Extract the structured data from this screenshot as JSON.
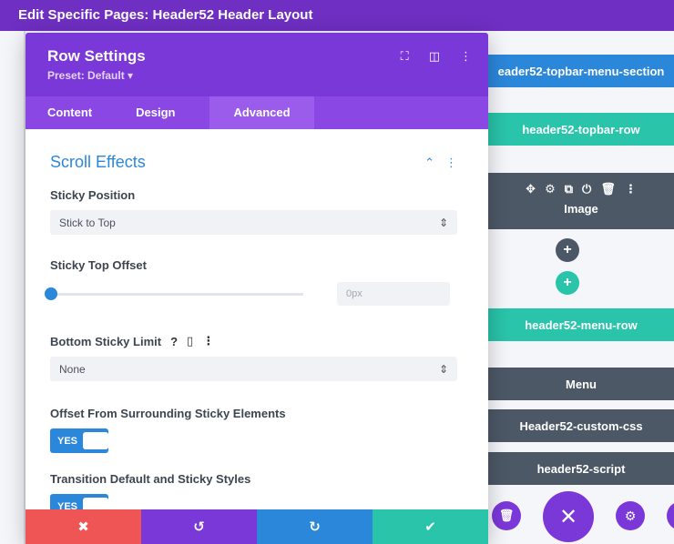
{
  "title_bar": {
    "text": "Edit Specific Pages: Header52 Header Layout"
  },
  "modal": {
    "title": "Row Settings",
    "preset": "Preset: Default ▾",
    "tabs": [
      {
        "label": "Content"
      },
      {
        "label": "Design"
      },
      {
        "label": "Advanced"
      }
    ],
    "section": {
      "title": "Scroll Effects"
    },
    "fields": {
      "sticky_position": {
        "label": "Sticky Position",
        "value": "Stick to Top"
      },
      "sticky_top_offset": {
        "label": "Sticky Top Offset",
        "value": "0px",
        "slider_fraction": 0.0
      },
      "bottom_sticky_limit": {
        "label": "Bottom Sticky Limit",
        "value": "None"
      },
      "offset_surrounding": {
        "label": "Offset From Surrounding Sticky Elements",
        "toggle": "YES"
      },
      "transition_default": {
        "label": "Transition Default and Sticky Styles",
        "toggle": "YES"
      }
    },
    "footer": {
      "cancel": "✖",
      "undo": "↺",
      "redo": "↻",
      "save": "✔"
    }
  },
  "builder": {
    "topbar_section": "eader52-topbar-menu-section",
    "topbar_row": "header52-topbar-row",
    "module_image": "Image",
    "menu_row": "header52-menu-row",
    "menu_module": "Menu",
    "custom_css": "Header52-custom-css",
    "script": "header52-script"
  },
  "colors": {
    "purple": "#7b38d8",
    "blue": "#2b87da",
    "teal": "#29c4a9",
    "red": "#ef5555",
    "dark": "#4c5866"
  }
}
